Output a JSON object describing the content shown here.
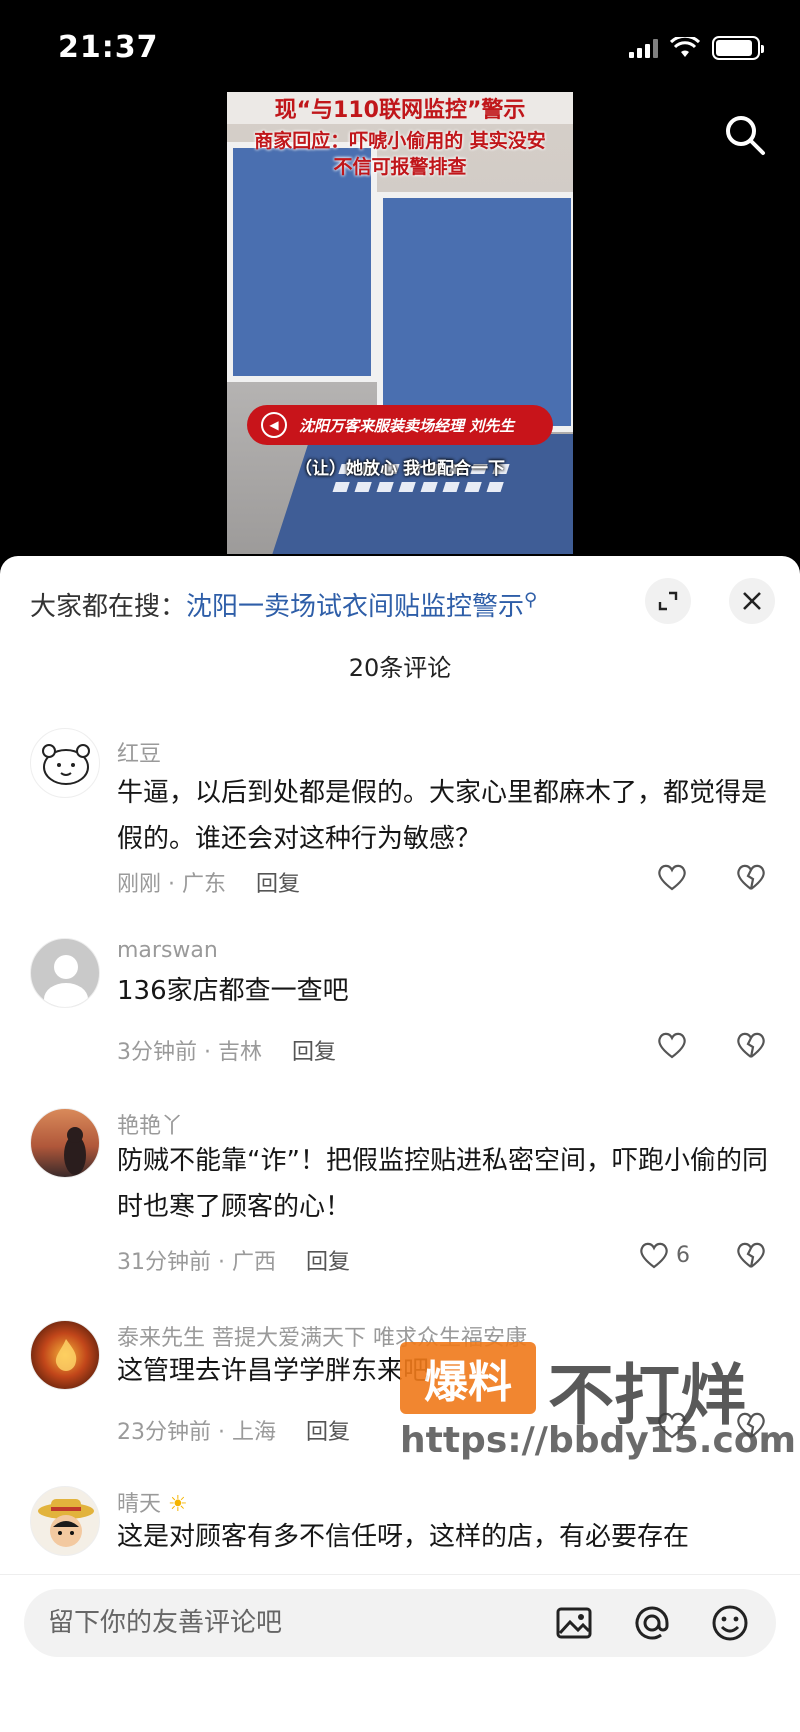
{
  "status": {
    "time": "21:37"
  },
  "video": {
    "caption_top": "现“与110联网监控”警示",
    "caption_line1": "商家回应：吓唬小偷用的 其实没安",
    "caption_line2": "不信可报警排查",
    "speaker_badge": "沈阳万客来服装卖场经理 刘先生",
    "subtitle": "（让）她放心 我也配合一下"
  },
  "sheet": {
    "search_prefix": "大家都在搜：",
    "search_keyword": "沈阳一卖场试衣间贴监控警示",
    "comment_count": "20条评论",
    "reply_label": "回复"
  },
  "comments": [
    {
      "user": "红豆",
      "text": "牛逼，以后到处都是假的。大家心里都麻木了，都觉得是假的。谁还会对这种行为敏感？",
      "time": "刚刚 · 广东",
      "likes": ""
    },
    {
      "user": "marswan",
      "text": "136家店都查一查吧",
      "time": "3分钟前 · 吉林",
      "likes": ""
    },
    {
      "user": "艳艳丫",
      "text": "防贼不能靠“诈”！把假监控贴进私密空间，吓跑小偷的同时也寒了顾客的心！",
      "time": "31分钟前 · 广西",
      "likes": "6"
    },
    {
      "user": "泰来先生 菩提大爱满天下 唯求众生福安康",
      "text": "这管理去许昌学学胖东来吧",
      "time": "23分钟前 · 上海",
      "likes": ""
    },
    {
      "user": "晴天",
      "text": "这是对顾客有多不信任呀，这样的店，有必要存在",
      "time": "",
      "likes": ""
    }
  ],
  "watermark": {
    "badge": "爆料",
    "title": "不打烊",
    "url": "https://bbdy15.com"
  },
  "input": {
    "placeholder": "留下你的友善评论吧"
  },
  "colors": {
    "accent_link": "#2e5ea8",
    "video_badge": "#c8141a",
    "watermark": "#f07a1a"
  }
}
